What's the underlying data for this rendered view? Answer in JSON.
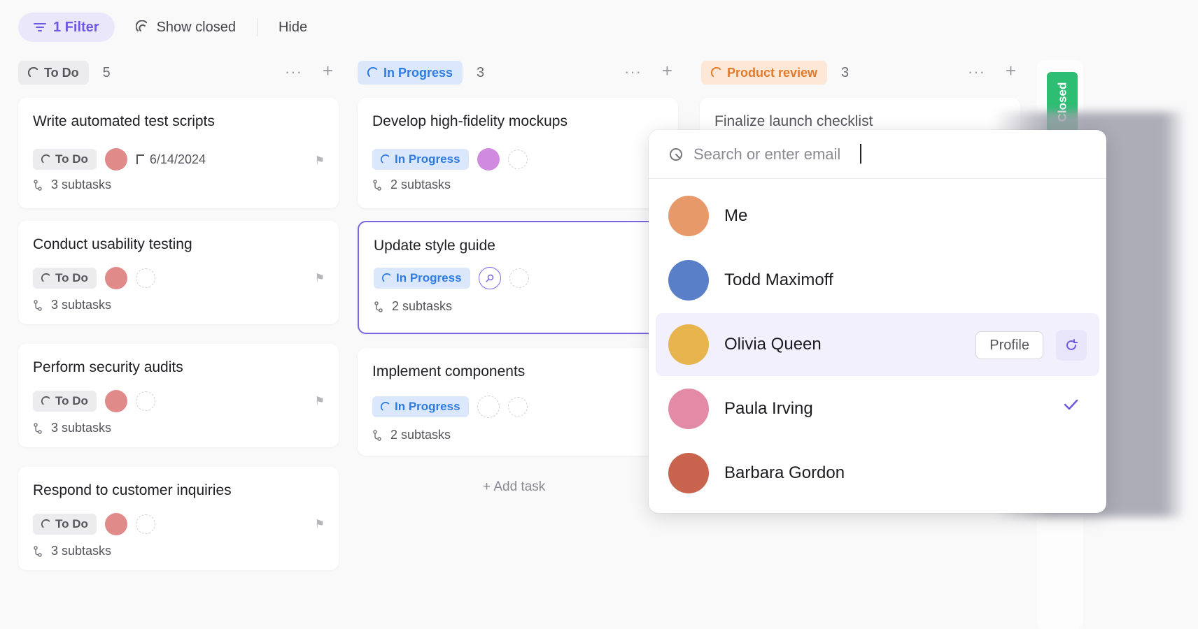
{
  "toolbar": {
    "filter_label": "1 Filter",
    "show_closed_label": "Show closed",
    "hide_label": "Hide"
  },
  "colors": {
    "accent": "#6d5ae0",
    "todo": "#55555c",
    "in_progress": "#2f7be0",
    "review": "#e27b2b",
    "closed": "#2dbd73"
  },
  "columns": [
    {
      "status": "To Do",
      "count": "5",
      "cards": [
        {
          "title": "Write automated test scripts",
          "status": "To Do",
          "date": "6/14/2024",
          "subtasks": "3 subtasks"
        },
        {
          "title": "Conduct usability testing",
          "status": "To Do",
          "subtasks": "3 subtasks"
        },
        {
          "title": "Perform security audits",
          "status": "To Do",
          "subtasks": "3 subtasks"
        },
        {
          "title": "Respond to customer inquiries",
          "status": "To Do",
          "subtasks": "3 subtasks"
        }
      ]
    },
    {
      "status": "In Progress",
      "count": "3",
      "cards": [
        {
          "title": "Develop high-fidelity mockups",
          "status": "In Progress",
          "subtasks": "2 subtasks"
        },
        {
          "title": "Update style guide",
          "status": "In Progress",
          "subtasks": "2 subtasks"
        },
        {
          "title": "Implement components",
          "status": "In Progress",
          "subtasks": "2 subtasks"
        }
      ],
      "add_task": "+ Add task"
    },
    {
      "status": "Product review",
      "count": "3",
      "cards": [
        {
          "title": "Finalize launch checklist"
        }
      ]
    }
  ],
  "closed_column": {
    "label": "Closed"
  },
  "assignee_dropdown": {
    "search_placeholder": "Search or enter email",
    "profile_label": "Profile",
    "people": [
      {
        "name": "Me",
        "color": "#e8996a"
      },
      {
        "name": "Todd Maximoff",
        "color": "#5a7fc9"
      },
      {
        "name": "Olivia Queen",
        "color": "#e8b44d"
      },
      {
        "name": "Paula Irving",
        "color": "#e38aa6"
      },
      {
        "name": "Barbara Gordon",
        "color": "#c8644e"
      }
    ]
  }
}
